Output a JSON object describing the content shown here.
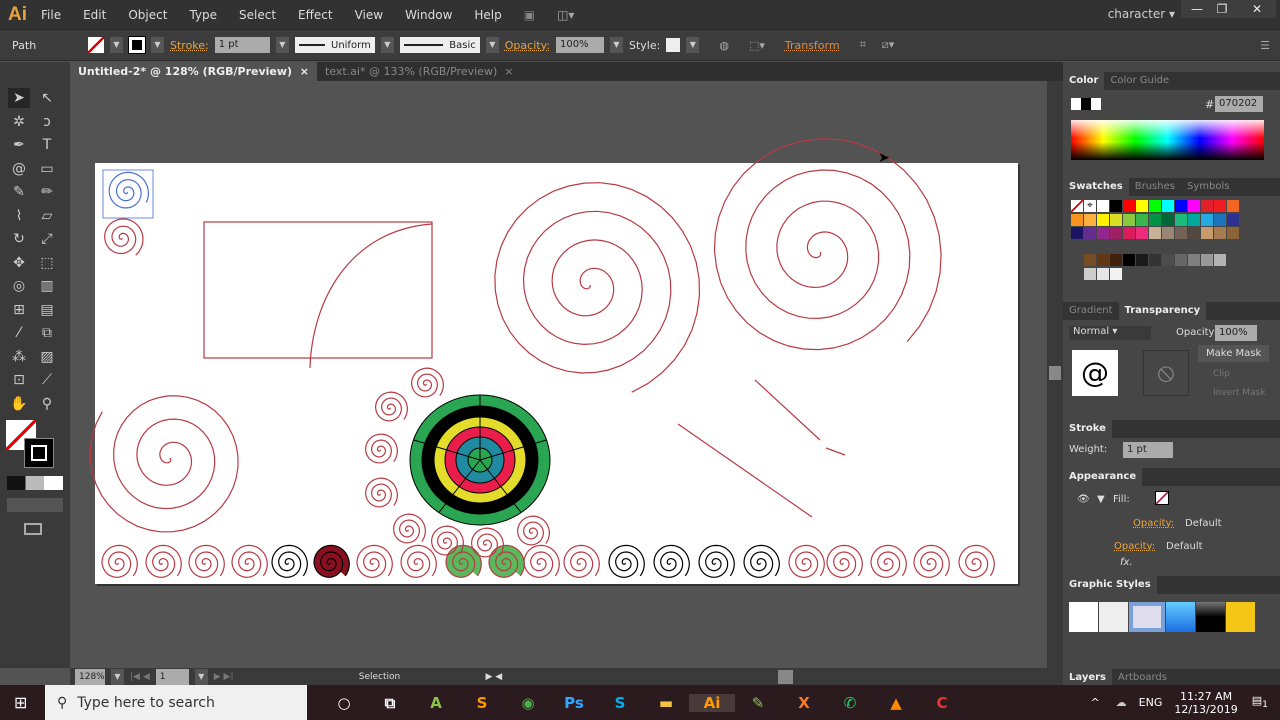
{
  "app": {
    "logo": "Ai",
    "workspace": "character",
    "minimize": "—",
    "restore": "❐",
    "close": "✕"
  },
  "menu": [
    "File",
    "Edit",
    "Object",
    "Type",
    "Select",
    "Effect",
    "View",
    "Window",
    "Help"
  ],
  "control": {
    "selection_type": "Path",
    "stroke_label": "Stroke:",
    "stroke_weight": "1 pt",
    "profile": "Uniform",
    "brush": "Basic",
    "opacity_label": "Opacity:",
    "opacity": "100%",
    "style_label": "Style:",
    "transform_label": "Transform"
  },
  "tabs": [
    {
      "label": "Untitled-2* @ 128% (RGB/Preview)",
      "active": true
    },
    {
      "label": "text.ai* @ 133% (RGB/Preview)",
      "active": false
    }
  ],
  "status": {
    "zoom": "128%",
    "artboard": "1",
    "tool": "Selection"
  },
  "panels": {
    "color": {
      "tabs": [
        "Color",
        "Color Guide"
      ],
      "hex_label": "#",
      "hex": "070202"
    },
    "swatches": {
      "tabs": [
        "Swatches",
        "Brushes",
        "Symbols"
      ],
      "colors": [
        "#ffffff",
        "#000000",
        "#ff0000",
        "#ffff00",
        "#00ff00",
        "#00ffff",
        "#0000ff",
        "#ff00ff",
        "#e0202a",
        "#ef1c24",
        "#f26522",
        "#f7941d",
        "#fbb040",
        "#fff200",
        "#d7df23",
        "#8dc63f",
        "#39b54a",
        "#009444",
        "#006838",
        "#1cbb7c",
        "#00a99d",
        "#27aae1",
        "#1c75bc",
        "#2e3192",
        "#1b1464",
        "#662d91",
        "#92278f",
        "#9e1f63",
        "#da1c5c",
        "#ee2a7b",
        "#c7b299",
        "#998675",
        "#736357",
        "#534741",
        "#c69c6d",
        "#a67c52",
        "#8c6239",
        "#754c24",
        "#603813",
        "#42210b",
        "#000000",
        "#1a1a1a",
        "#333333",
        "#4d4d4d",
        "#666666",
        "#808080",
        "#999999",
        "#b3b3b3",
        "#cccccc",
        "#e6e6e6",
        "#f2f2f2",
        "#8cab1b",
        "#8e3fe0",
        "#f7a11c"
      ]
    },
    "transparency": {
      "tabs": [
        "Gradient",
        "Transparency"
      ],
      "blend": "Normal",
      "opacity_label": "Opacity:",
      "opacity": "100%",
      "make_mask": "Make Mask",
      "clip": "Clip",
      "invert": "Invert Mask"
    },
    "stroke": {
      "title": "Stroke",
      "weight_label": "Weight:",
      "weight": "1 pt"
    },
    "appearance": {
      "title": "Appearance",
      "fill_label": "Fill:",
      "opacity_label": "Opacity:",
      "opacity_value": "Default",
      "opacity_label2": "Opacity:",
      "opacity_value2": "Default",
      "fx": "fx."
    },
    "graphic_styles": {
      "title": "Graphic Styles"
    },
    "layers": {
      "tabs": [
        "Layers",
        "Artboards"
      ]
    }
  },
  "colors": {
    "stroke": "#b83a44",
    "selection": "#4a6fd6",
    "target": [
      "#2aa552",
      "#000000",
      "#e3dc2a",
      "#ea1e4b",
      "#1f8aa0",
      "#2aa552"
    ]
  },
  "taskbar": {
    "search_placeholder": "Type here to search",
    "lang": "ENG",
    "time": "11:27 AM",
    "date": "12/13/2019",
    "notifications": "1",
    "apps": [
      {
        "name": "cortana",
        "glyph": "○",
        "color": "#fff"
      },
      {
        "name": "task-view",
        "glyph": "⧉",
        "color": "#fff"
      },
      {
        "name": "android-studio",
        "glyph": "A",
        "color": "#8bc34a"
      },
      {
        "name": "sublime",
        "glyph": "S",
        "color": "#ff9800"
      },
      {
        "name": "chrome",
        "glyph": "◉",
        "color": "#4caf50"
      },
      {
        "name": "photoshop",
        "glyph": "Ps",
        "color": "#31a8ff"
      },
      {
        "name": "skype",
        "glyph": "S",
        "color": "#00aff0"
      },
      {
        "name": "file-explorer",
        "glyph": "▬",
        "color": "#f5c342"
      },
      {
        "name": "illustrator",
        "glyph": "Ai",
        "color": "#ff9a00"
      },
      {
        "name": "notepad",
        "glyph": "✎",
        "color": "#8bc34a"
      },
      {
        "name": "xampp",
        "glyph": "X",
        "color": "#fb7a24"
      },
      {
        "name": "whatsapp",
        "glyph": "✆",
        "color": "#25d366"
      },
      {
        "name": "vlc",
        "glyph": "▲",
        "color": "#ff8800"
      },
      {
        "name": "camtasia",
        "glyph": "C",
        "color": "#e53935"
      }
    ]
  }
}
